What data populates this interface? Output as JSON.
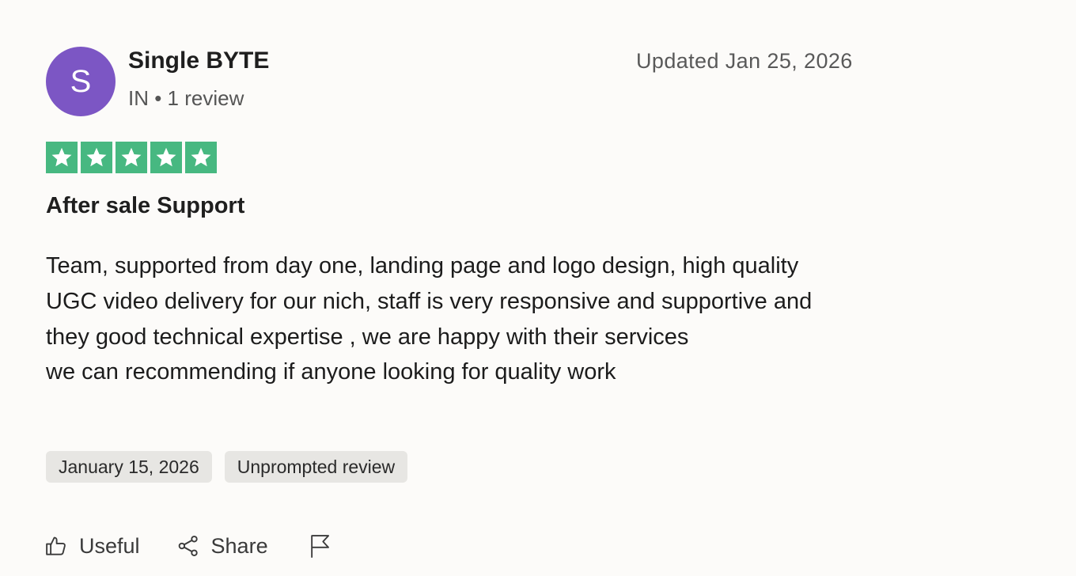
{
  "reviewer": {
    "avatar_initial": "S",
    "name": "Single BYTE",
    "meta": "IN • 1 review"
  },
  "updated_label": "Updated Jan 25, 2026",
  "rating": {
    "stars": 5,
    "max": 5,
    "color": "#47b881"
  },
  "review": {
    "title": "After sale Support",
    "body_lines": [
      "Team, supported from day one, landing page and logo design, high quality UGC video delivery for our nich, staff is very responsive and supportive and they good technical expertise , we are happy with their services",
      "we can recommending if anyone looking for quality work"
    ]
  },
  "tags": {
    "date": "January 15, 2026",
    "type": "Unprompted review"
  },
  "actions": {
    "useful_label": "Useful",
    "share_label": "Share",
    "report_icon": "flag-icon"
  },
  "colors": {
    "avatar": "#7c56c4",
    "star": "#47b881",
    "background": "#fcfbf9",
    "tag_bg": "#e7e6e3"
  }
}
